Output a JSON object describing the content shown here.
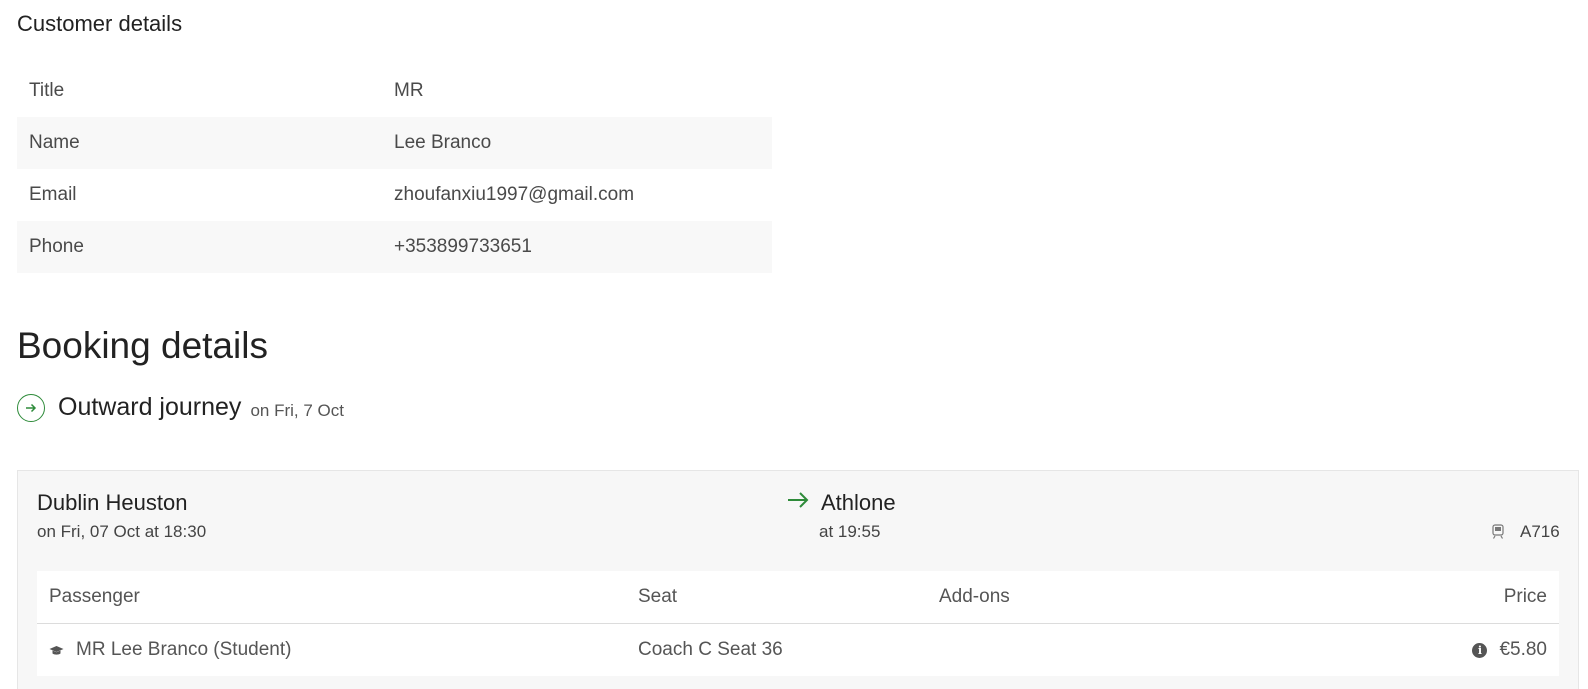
{
  "customer": {
    "heading": "Customer details",
    "rows": [
      {
        "label": "Title",
        "value": "MR"
      },
      {
        "label": "Name",
        "value": "Lee Branco"
      },
      {
        "label": "Email",
        "value": "zhoufanxiu1997@gmail.com"
      },
      {
        "label": "Phone",
        "value": "+353899733651"
      }
    ]
  },
  "booking": {
    "heading": "Booking details",
    "journey": {
      "icon": "arrow-right-circle-icon",
      "title": "Outward journey",
      "date": "on Fri, 7 Oct"
    },
    "leg": {
      "from_station": "Dublin Heuston",
      "from_time": "on Fri, 07 Oct  at 18:30",
      "to_station": "Athlone",
      "to_time": "at 19:55",
      "train_icon": "train-icon",
      "train_id": "A716"
    },
    "passenger_table": {
      "headers": {
        "passenger": "Passenger",
        "seat": "Seat",
        "addons": "Add-ons",
        "price": "Price"
      },
      "rows": [
        {
          "icon": "graduation-cap-icon",
          "passenger": "MR Lee Branco  (Student)",
          "seat": "Coach C  Seat 36",
          "addons": "",
          "price": "€5.80"
        }
      ]
    }
  },
  "colors": {
    "accent_green": "#2e8b3a",
    "row_shade": "#f8f8f8"
  }
}
